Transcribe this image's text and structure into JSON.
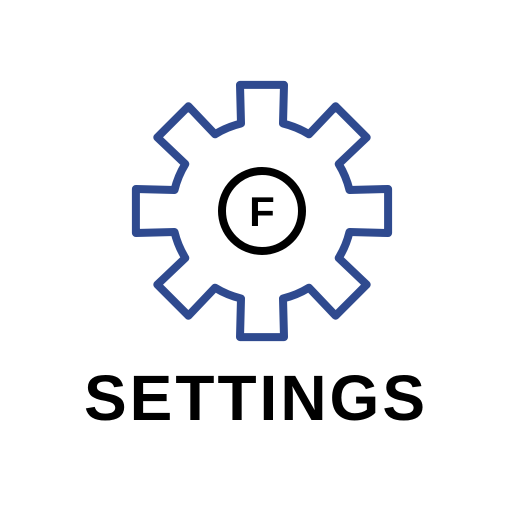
{
  "icon": {
    "name": "gear-icon",
    "badge_letter": "F",
    "stroke_color": "#2f4a8f",
    "letter_color": "#000000"
  },
  "title": "SETTINGS"
}
